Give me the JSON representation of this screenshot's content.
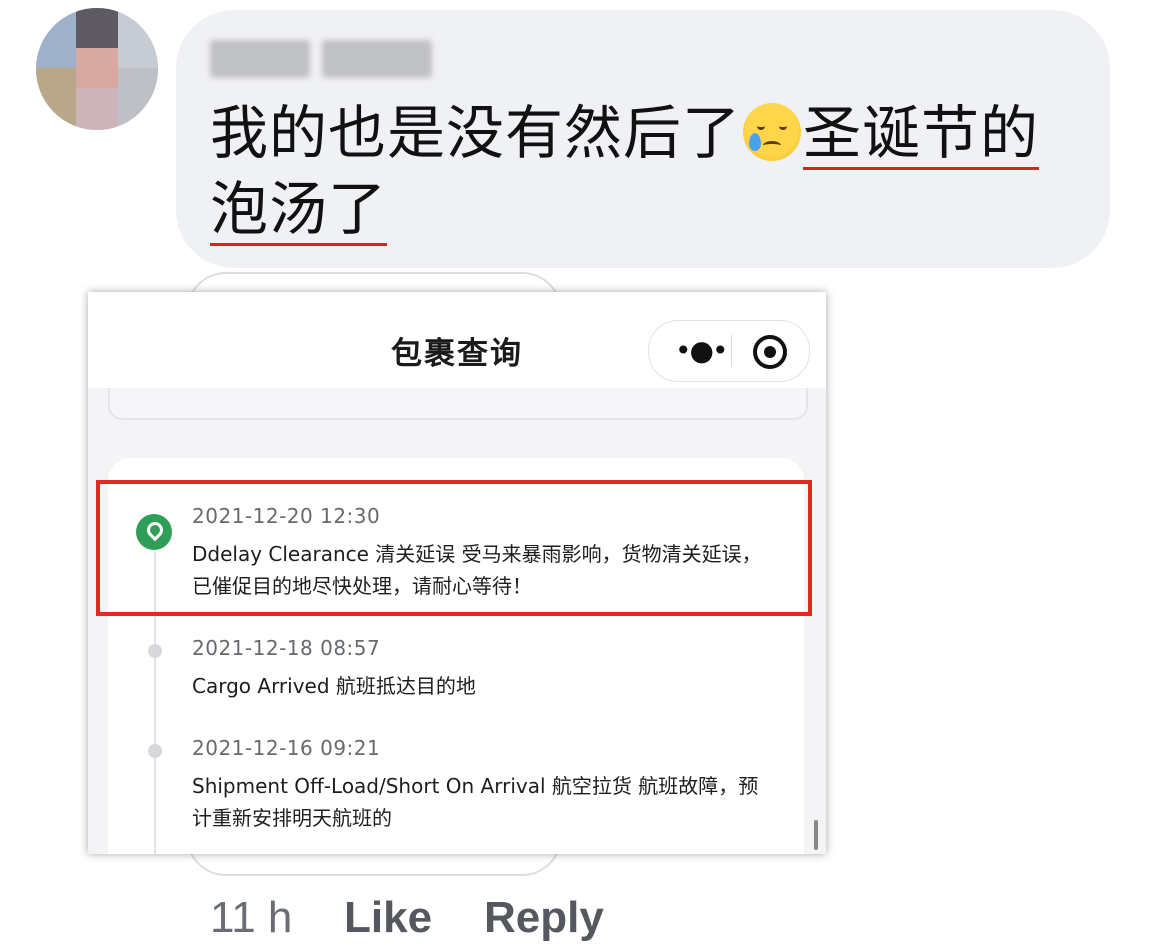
{
  "comment": {
    "author": "",
    "text_line1_prefix": "我的也是没有然后了",
    "emoji": "crying-face-emoji",
    "text_line1_underlined": "圣诞节的",
    "text_line2_underlined": "泡汤了",
    "time": "11 h",
    "like_label": "Like",
    "reply_label": "Reply"
  },
  "attachment": {
    "title": "包裹查询",
    "menu_icon": "more-dots-icon",
    "close_icon": "target-icon",
    "events": [
      {
        "time": "2021-12-20 12:30",
        "desc": "Ddelay Clearance 清关延误 受马来暴雨影响，货物清关延误，已催促目的地尽快处理，请耐心等待！",
        "highlighted": true
      },
      {
        "time": "2021-12-18 08:57",
        "desc": "Cargo Arrived 航班抵达目的地",
        "highlighted": false
      },
      {
        "time": "2021-12-16 09:21",
        "desc": "Shipment Off-Load/Short On Arrival 航空拉货 航班故障，预计重新安排明天航班的",
        "highlighted": false
      }
    ]
  },
  "colors": {
    "bubble_bg": "#f0f1f4",
    "underline": "#e02020",
    "highlight_box": "#e12a20",
    "pin_green": "#2f9e58"
  }
}
